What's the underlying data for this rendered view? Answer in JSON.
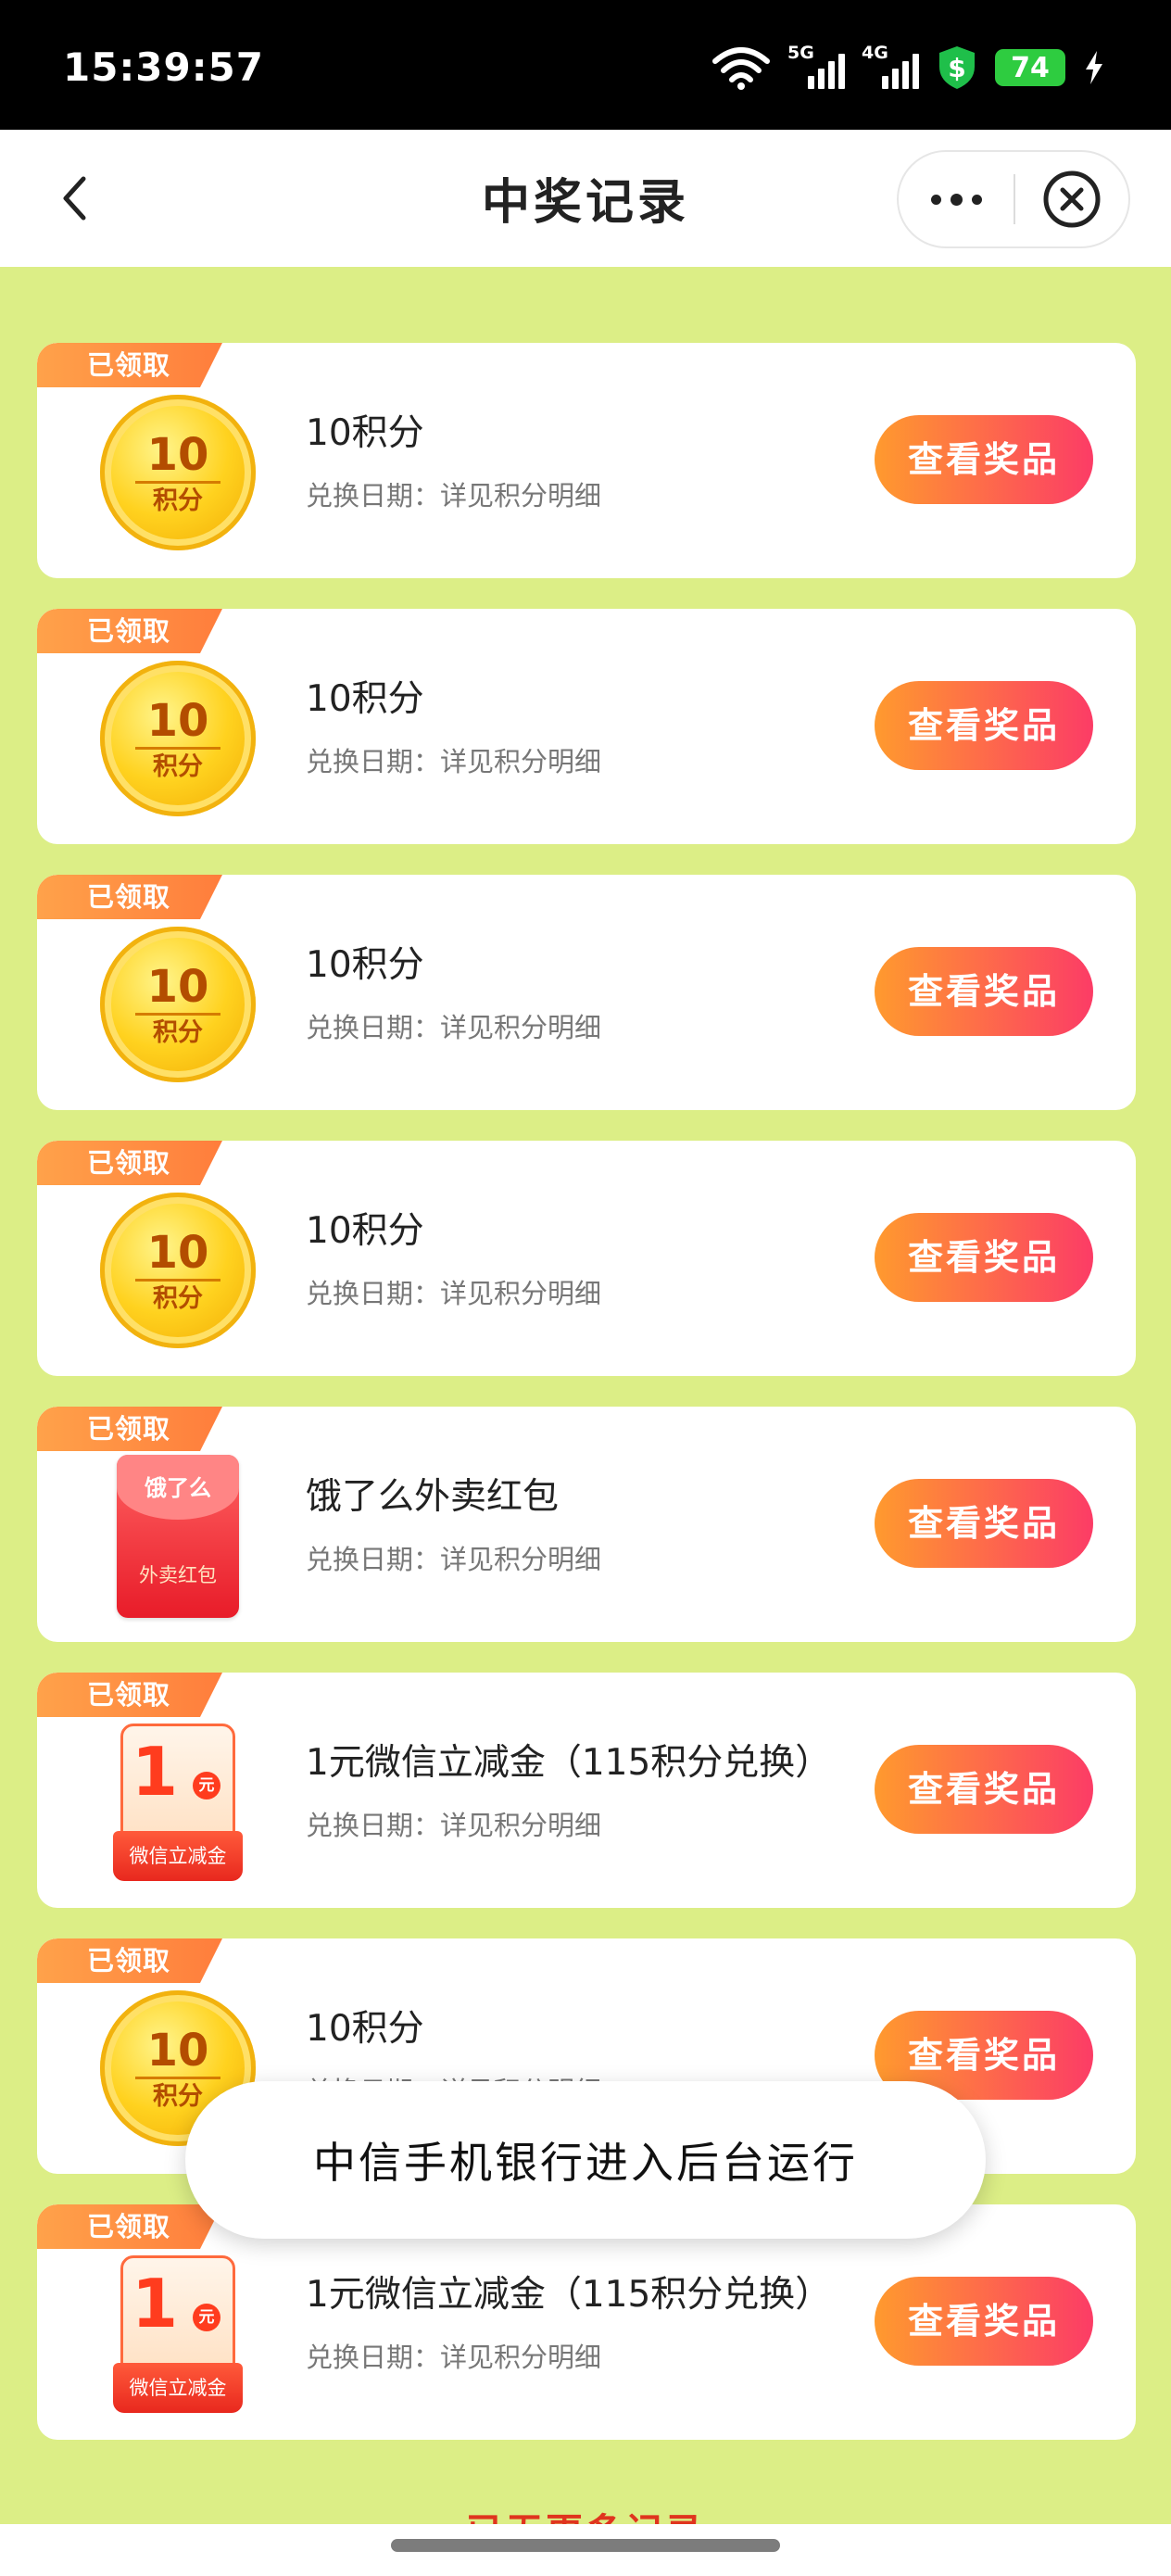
{
  "status_bar": {
    "time": "15:39:57",
    "network_1": "5G",
    "network_2": "4G",
    "battery": "74",
    "icons": [
      "wifi-icon",
      "signal-icon",
      "dollar-shield-icon",
      "battery-icon",
      "charging-icon"
    ]
  },
  "nav": {
    "title": "中奖记录",
    "back_icon": "chevron-left-icon",
    "more_icon": "more-icon",
    "close_icon": "close-circle-icon"
  },
  "records": [
    {
      "tag": "已领取",
      "icon_type": "coin",
      "coin_value": "10",
      "coin_unit": "积分",
      "name": "10积分",
      "date": "兑换日期：详见积分明细",
      "button": "查看奖品"
    },
    {
      "tag": "已领取",
      "icon_type": "coin",
      "coin_value": "10",
      "coin_unit": "积分",
      "name": "10积分",
      "date": "兑换日期：详见积分明细",
      "button": "查看奖品"
    },
    {
      "tag": "已领取",
      "icon_type": "coin",
      "coin_value": "10",
      "coin_unit": "积分",
      "name": "10积分",
      "date": "兑换日期：详见积分明细",
      "button": "查看奖品"
    },
    {
      "tag": "已领取",
      "icon_type": "coin",
      "coin_value": "10",
      "coin_unit": "积分",
      "name": "10积分",
      "date": "兑换日期：详见积分明细",
      "button": "查看奖品"
    },
    {
      "tag": "已领取",
      "icon_type": "envelope",
      "envelope_brand": "饿了么",
      "envelope_label": "外卖红包",
      "name": "饿了么外卖红包",
      "date": "兑换日期：详见积分明细",
      "button": "查看奖品"
    },
    {
      "tag": "已领取",
      "icon_type": "voucher",
      "voucher_value": "1",
      "voucher_unit": "元",
      "voucher_label": "微信立减金",
      "name": "1元微信立减金（115积分兑换）",
      "date": "兑换日期：详见积分明细",
      "button": "查看奖品"
    },
    {
      "tag": "已领取",
      "icon_type": "coin",
      "coin_value": "10",
      "coin_unit": "积分",
      "name": "10积分",
      "date": "兑换日期：详见积分明细",
      "button": "查看奖品"
    },
    {
      "tag": "已领取",
      "icon_type": "voucher",
      "voucher_value": "1",
      "voucher_unit": "元",
      "voucher_label": "微信立减金",
      "name": "1元微信立减金（115积分兑换）",
      "date": "兑换日期：详见积分明细",
      "button": "查看奖品"
    }
  ],
  "footer": {
    "no_more": "已无更多记录"
  },
  "toast": {
    "message": "中信手机银行进入后台运行"
  },
  "colors": {
    "background": "#dcee86",
    "tag": "#ff8a3d",
    "button_start": "#ff9a2e",
    "button_end": "#fc3c66"
  }
}
